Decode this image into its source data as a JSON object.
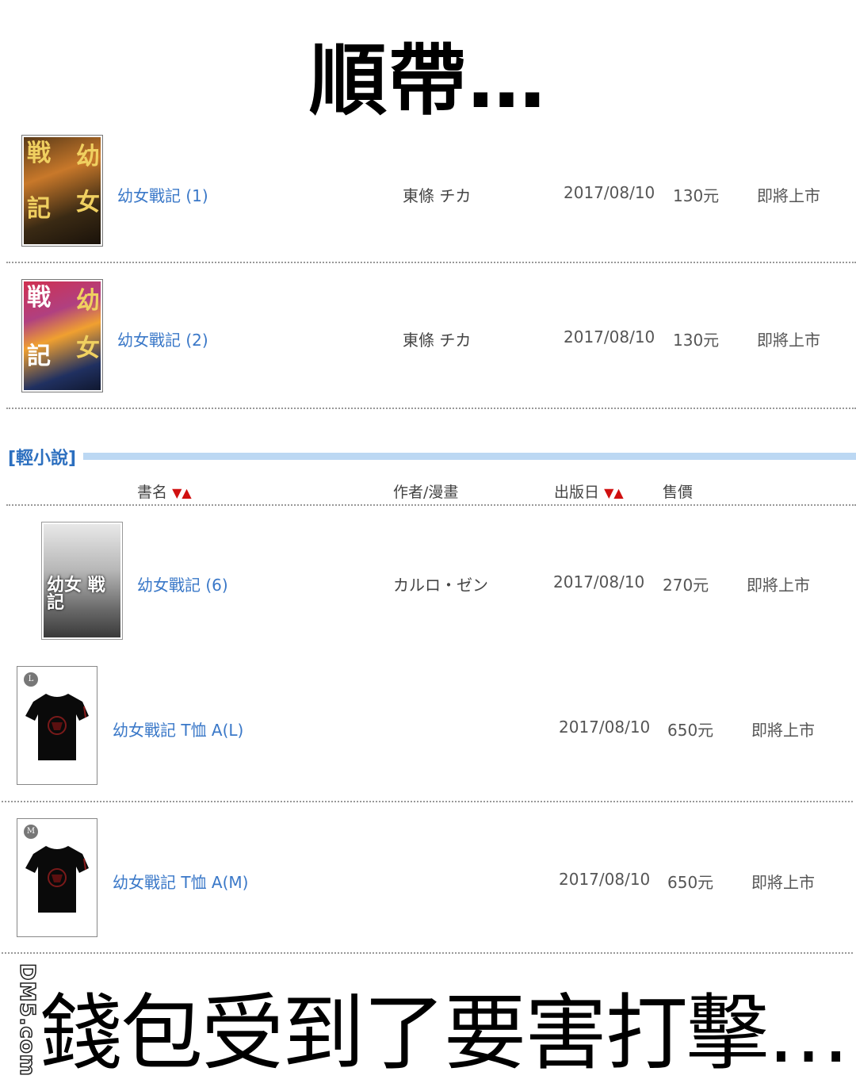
{
  "headline": "順帶…",
  "footline": "錢包受到了要害打擊…",
  "comic_rows": [
    {
      "title": "幼女戰記 (1)",
      "author": "東條 チカ",
      "date": "2017/08/10",
      "price": "130元",
      "status": "即將上市"
    },
    {
      "title": "幼女戰記 (2)",
      "author": "東條 チカ",
      "date": "2017/08/10",
      "price": "130元",
      "status": "即將上市"
    }
  ],
  "cover_text": {
    "c1": "戦",
    "c2": "幼",
    "c3": "記",
    "c4": "女",
    "ln": "幼女 戦記"
  },
  "section": {
    "title": "[輕小說]"
  },
  "table_header": {
    "title": "書名",
    "author": "作者/漫畫",
    "date": "出版日",
    "price": "售價",
    "arrow_down": "▼",
    "arrow_up": "▲"
  },
  "novel_rows": [
    {
      "title": "幼女戰記 (6)",
      "author": "カルロ・ゼン",
      "date": "2017/08/10",
      "price": "270元",
      "status": "即將上市"
    }
  ],
  "merch_rows": [
    {
      "title": "幼女戰記 T恤 A(L)",
      "size_badge": "L",
      "date": "2017/08/10",
      "price": "650元",
      "status": "即將上市"
    },
    {
      "title": "幼女戰記 T恤 A(M)",
      "size_badge": "M",
      "date": "2017/08/10",
      "price": "650元",
      "status": "即將上市"
    }
  ],
  "watermark": "DM5.com",
  "colors": {
    "link": "#3a78c8",
    "section_title": "#2c6fbf",
    "section_bar": "#bcd8f3",
    "sort_arrow": "#d01010"
  }
}
